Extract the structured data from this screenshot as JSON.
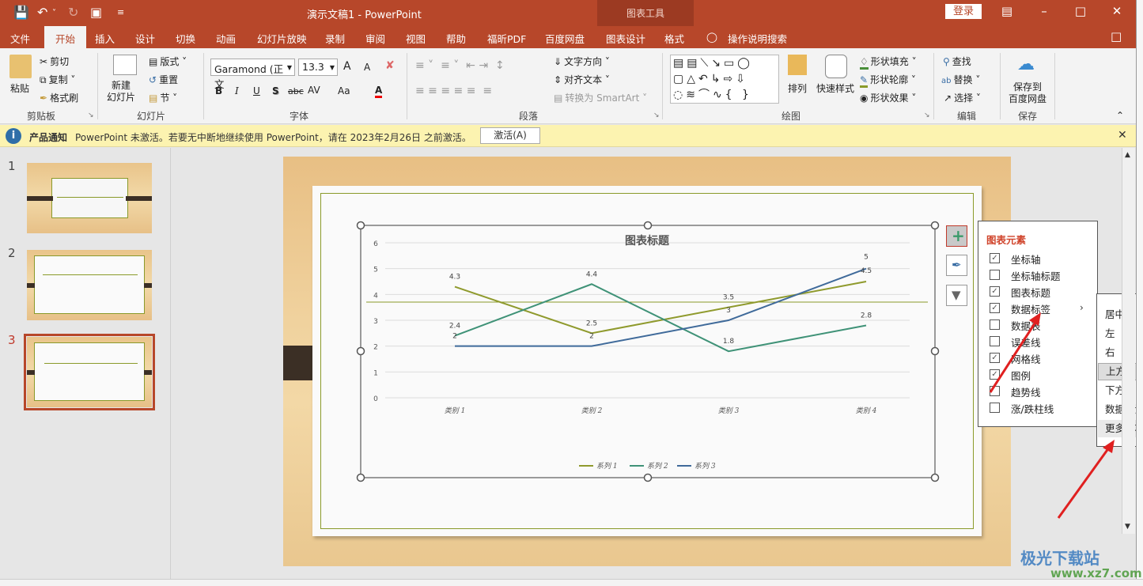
{
  "titlebar": {
    "doc_title": "演示文稿1  -  PowerPoint",
    "context_group": "图表工具",
    "login": "登录",
    "quick_access": [
      "save-icon",
      "undo-icon",
      "redo-icon",
      "present-icon",
      "customize-icon"
    ]
  },
  "tabs": [
    "文件",
    "开始",
    "插入",
    "设计",
    "切换",
    "动画",
    "幻灯片放映",
    "录制",
    "审阅",
    "视图",
    "帮助",
    "福昕PDF",
    "百度网盘",
    "图表设计",
    "格式"
  ],
  "active_tab": "开始",
  "tell_me": "操作说明搜索",
  "ribbon": {
    "clipboard": {
      "label": "剪贴板",
      "paste": "粘贴",
      "cut": "剪切",
      "copy": "复制",
      "format_painter": "格式刷"
    },
    "slides": {
      "label": "幻灯片",
      "new_slide": "新建\n幻灯片",
      "layout": "版式",
      "reset": "重置",
      "section": "节"
    },
    "font": {
      "label": "字体",
      "font_name": "Garamond (正文",
      "font_size": "13.3",
      "bold": "B",
      "italic": "I",
      "underline": "U",
      "shadow": "S",
      "strike": "abc",
      "spacing": "AV",
      "case": "Aa",
      "color": "A",
      "grow": "A",
      "shrink": "A"
    },
    "paragraph": {
      "label": "段落",
      "text_direction": "文字方向",
      "align_text": "对齐文本",
      "smartart": "转换为 SmartArt"
    },
    "drawing": {
      "label": "绘图",
      "arrange": "排列",
      "quick_styles": "快速样式",
      "shape_fill": "形状填充",
      "shape_outline": "形状轮廓",
      "shape_effects": "形状效果"
    },
    "editing": {
      "label": "编辑",
      "find": "查找",
      "replace": "替换",
      "select": "选择"
    },
    "save": {
      "label": "保存",
      "save_to": "保存到\n百度网盘"
    }
  },
  "notice": {
    "title": "产品通知",
    "message": "PowerPoint 未激活。若要无中断地继续使用 PowerPoint，请在 2023年2月26日 之前激活。",
    "button": "激活(A)"
  },
  "thumbnails": [
    {
      "num": "1"
    },
    {
      "num": "2"
    },
    {
      "num": "3",
      "active": true
    }
  ],
  "chart_data": {
    "type": "line",
    "title": "图表标题",
    "categories": [
      "类别 1",
      "类别 2",
      "类别 3",
      "类别 4"
    ],
    "series": [
      {
        "name": "系列 1",
        "color": "#8f9a2d",
        "values": [
          4.3,
          2.5,
          3.5,
          4.5
        ]
      },
      {
        "name": "系列 2",
        "color": "#3f9277",
        "values": [
          2.4,
          4.4,
          1.8,
          2.8
        ]
      },
      {
        "name": "系列 3",
        "color": "#3f6a9a",
        "values": [
          2,
          2,
          3,
          5
        ]
      }
    ],
    "ylim": [
      0,
      6
    ],
    "yticks": [
      0,
      1,
      2,
      3,
      4,
      5,
      6
    ],
    "grid": true,
    "legend": "bottom",
    "data_labels": "above"
  },
  "chart_elements_panel": {
    "title": "图表元素",
    "items": [
      {
        "label": "坐标轴",
        "checked": true
      },
      {
        "label": "坐标轴标题",
        "checked": false
      },
      {
        "label": "图表标题",
        "checked": true
      },
      {
        "label": "数据标签",
        "checked": true,
        "submenu": true
      },
      {
        "label": "数据表",
        "checked": false
      },
      {
        "label": "误差线",
        "checked": false
      },
      {
        "label": "网格线",
        "checked": true
      },
      {
        "label": "图例",
        "checked": true
      },
      {
        "label": "趋势线",
        "checked": false
      },
      {
        "label": "涨/跌柱线",
        "checked": false
      }
    ]
  },
  "data_label_submenu": {
    "items": [
      "居中",
      "左",
      "右",
      "上方",
      "下方",
      "数据标注",
      "更多选项..."
    ],
    "highlighted": "上方"
  },
  "watermark": {
    "line1": "极光下载站",
    "line2": "www.xz7.com"
  }
}
